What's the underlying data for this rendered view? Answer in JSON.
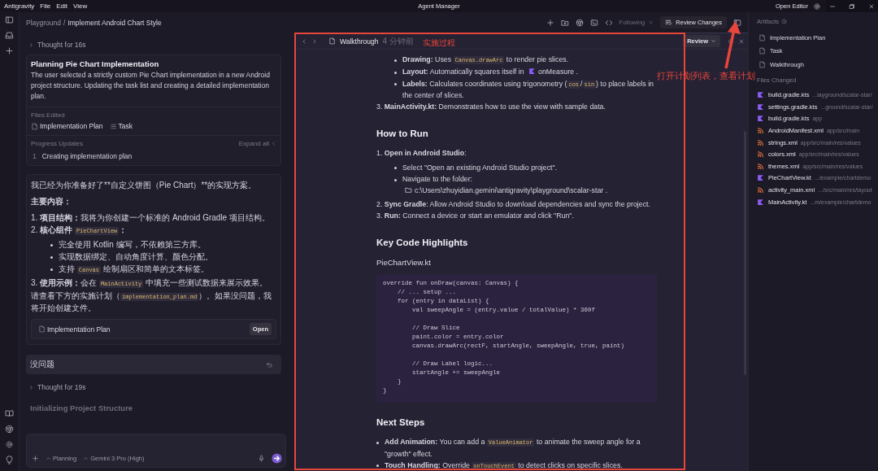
{
  "title_bar": {
    "menu": [
      "Antigravity",
      "File",
      "Edit",
      "View"
    ],
    "title": "Agent Manager",
    "open_editor": "Open Editor"
  },
  "conversation": {
    "breadcrumb": [
      "Playground",
      "Implement Android Chart Style"
    ],
    "breadcrumb_separator": "/",
    "thought_1": "Thought for 16s",
    "step_card": {
      "title": "Planning Pie Chart Implementation",
      "body": "The user selected a strictly custom Pie Chart implementation in a new Android project structure. Updating the task list and creating a detailed implementation plan.",
      "files_label": "Files Edited",
      "files": [
        {
          "name": "Implementation Plan",
          "kind": "doc"
        },
        {
          "name": "Task",
          "kind": "list"
        }
      ],
      "progress_label": "Progress Updates",
      "expand": "Expand all",
      "updates": [
        {
          "number": "1",
          "text": "Creating implementation plan"
        }
      ]
    },
    "message": {
      "blocks": [
        {
          "kind": "paragraph",
          "parts": [
            {
              "kind": "text",
              "text": "我已经为你准备好了**自定义饼图（Pie Chart）**的实现方案。"
            }
          ]
        },
        {
          "kind": "paragraph",
          "parts": [
            {
              "kind": "bold",
              "text": "主要内容："
            }
          ]
        },
        {
          "kind": "item",
          "number": "1.",
          "parts": [
            {
              "kind": "bold",
              "text": "项目结构："
            },
            {
              "kind": "text",
              "text": "我将为你创建一个标准的 Android Gradle 项目结构。"
            }
          ]
        },
        {
          "kind": "item",
          "number": "2.",
          "parts": [
            {
              "kind": "bold",
              "text": "核心组件 "
            },
            {
              "kind": "code",
              "text": "PieChartView"
            },
            {
              "kind": "bold",
              "text": "："
            }
          ],
          "children": [
            {
              "kind": "item",
              "parts": [
                {
                  "kind": "text",
                  "text": "完全使用 Kotlin 编写，不依赖第三方库。"
                }
              ]
            },
            {
              "kind": "item",
              "parts": [
                {
                  "kind": "text",
                  "text": "实现数据绑定、自动角度计算、颜色分配。"
                }
              ]
            },
            {
              "kind": "item",
              "parts": [
                {
                  "kind": "text",
                  "text": "支持 "
                },
                {
                  "kind": "code",
                  "text": "Canvas"
                },
                {
                  "kind": "text",
                  "text": " 绘制扇区和简单的文本标签。"
                }
              ]
            }
          ]
        },
        {
          "kind": "item",
          "number": "3.",
          "parts": [
            {
              "kind": "bold",
              "text": "使用示例："
            },
            {
              "kind": "text",
              "text": "会在 "
            },
            {
              "kind": "code",
              "text": "MainActivity"
            },
            {
              "kind": "text",
              "text": " 中填充一些测试数据来展示效果。"
            }
          ]
        },
        {
          "kind": "paragraph",
          "parts": [
            {
              "kind": "text",
              "text": "请查看下方的实施计划（"
            },
            {
              "kind": "code",
              "text": "implementation_plan.md"
            },
            {
              "kind": "text",
              "text": "）。如果没问题，我将开始创建文件。"
            }
          ]
        }
      ],
      "attachment": {
        "name": "Implementation Plan",
        "button": "Open"
      }
    },
    "user_message": "没问题",
    "thought_2": "Thought for 19s",
    "step_title": "Initializing Project Structure",
    "input": {
      "mode": "Planning",
      "model": "Gemini 3 Pro (High)"
    }
  },
  "toolbar": {
    "following": {
      "label": "Following",
      "disabled": true
    },
    "review_changes": "Review Changes"
  },
  "document": {
    "title": "Walkthrough",
    "age": "4 分钟前",
    "review": "Review",
    "blocks": [
      {
        "kind": "sub_item",
        "parts": [
          {
            "kind": "bold",
            "text": "Drawing:"
          },
          {
            "kind": "text",
            "text": " Uses "
          },
          {
            "kind": "code",
            "text": "Canvas.drawArc"
          },
          {
            "kind": "text",
            "text": " to render pie slices."
          }
        ]
      },
      {
        "kind": "sub_item",
        "parts": [
          {
            "kind": "bold",
            "text": "Layout:"
          },
          {
            "kind": "text",
            "text": " Automatically squares itself in "
          },
          {
            "kind": "file_icon"
          },
          {
            "kind": "text",
            "text": "onMeasure ."
          }
        ]
      },
      {
        "kind": "sub_item",
        "parts": [
          {
            "kind": "bold",
            "text": "Labels:"
          },
          {
            "kind": "text",
            "text": " Calculates coordinates using trigonometry ("
          },
          {
            "kind": "code",
            "text": "cos"
          },
          {
            "kind": "text",
            "text": "/"
          },
          {
            "kind": "code",
            "text": "sin"
          },
          {
            "kind": "text",
            "text": ") to place labels in the center of slices."
          }
        ]
      },
      {
        "kind": "item",
        "number": "3.",
        "parts": [
          {
            "kind": "bold",
            "text": "MainActivity.kt:"
          },
          {
            "kind": "text",
            "text": " Demonstrates how to use the view with sample data."
          }
        ]
      },
      {
        "kind": "heading",
        "text": "How to Run"
      },
      {
        "kind": "item",
        "number": "1.",
        "parts": [
          {
            "kind": "bold",
            "text": "Open in Android Studio"
          },
          {
            "kind": "text",
            "text": ":"
          }
        ],
        "children": [
          {
            "kind": "item",
            "parts": [
              {
                "kind": "text",
                "text": "Select \"Open an existing Android Studio project\"."
              }
            ]
          },
          {
            "kind": "item",
            "parts": [
              {
                "kind": "text",
                "text": "Navigate to the folder:"
              },
              {
                "kind": "break"
              },
              {
                "kind": "folder_icon"
              },
              {
                "kind": "text",
                "text": "c:\\Users\\zhuyidian.gemini\\antigravity\\playground\\scalar-star ."
              }
            ]
          }
        ]
      },
      {
        "kind": "item",
        "number": "2.",
        "parts": [
          {
            "kind": "bold",
            "text": "Sync Gradle"
          },
          {
            "kind": "text",
            "text": ": Allow Android Studio to download dependencies and sync the project."
          }
        ]
      },
      {
        "kind": "item",
        "number": "3.",
        "parts": [
          {
            "kind": "bold",
            "text": "Run:"
          },
          {
            "kind": "text",
            "text": " Connect a device or start an emulator and click \"Run\"."
          }
        ]
      },
      {
        "kind": "heading",
        "text": "Key Code Highlights"
      },
      {
        "kind": "label",
        "text": "PieChartView.kt"
      },
      {
        "kind": "code",
        "text": "override fun onDraw(canvas: Canvas) {\n    // ... setup ...\n    for (entry in dataList) {\n        val sweepAngle = (entry.value / totalValue) * 360f\n\n        // Draw Slice\n        paint.color = entry.color\n        canvas.drawArc(rectF, startAngle, sweepAngle, true, paint)\n\n        // Draw Label logic...\n        startAngle += sweepAngle\n    }\n}"
      },
      {
        "kind": "heading",
        "text": "Next Steps"
      },
      {
        "kind": "item",
        "parts": [
          {
            "kind": "bold",
            "text": "Add Animation:"
          },
          {
            "kind": "text",
            "text": " You can add a "
          },
          {
            "kind": "code",
            "text": "ValueAnimator"
          },
          {
            "kind": "text",
            "text": " to animate the sweep angle for a \"growth\" effect."
          }
        ]
      },
      {
        "kind": "item",
        "parts": [
          {
            "kind": "bold",
            "text": "Touch Handling:"
          },
          {
            "kind": "text",
            "text": " Override "
          },
          {
            "kind": "code",
            "text": "onTouchEvent"
          },
          {
            "kind": "text",
            "text": " to detect clicks on specific slices."
          }
        ]
      }
    ]
  },
  "artifacts": {
    "label": "Artifacts",
    "items": [
      "Implementation Plan",
      "Task",
      "Walkthrough"
    ],
    "files_label": "Files Changed",
    "files": [
      {
        "name": "build.gradle.kts",
        "path": "...layground/scalar-star/",
        "kind": "kotlin"
      },
      {
        "name": "settings.gradle.kts",
        "path": "...ground/scalar-star/",
        "kind": "kotlin"
      },
      {
        "name": "build.gradle.kts",
        "path": "app",
        "kind": "kotlin"
      },
      {
        "name": "AndroidManifest.xml",
        "path": "app/src/main",
        "kind": "xml"
      },
      {
        "name": "strings.xml",
        "path": "app/src/main/res/values",
        "kind": "xml"
      },
      {
        "name": "colors.xml",
        "path": "app/src/main/res/values",
        "kind": "xml"
      },
      {
        "name": "themes.xml",
        "path": "app/src/main/res/values",
        "kind": "xml"
      },
      {
        "name": "PieChartView.kt",
        "path": ".../example/chartdemo",
        "kind": "kotlin"
      },
      {
        "name": "activity_main.xml",
        "path": ".../src/main/res/layout",
        "kind": "xml"
      },
      {
        "name": "MainActivity.kt",
        "path": "...m/example/chartdemo",
        "kind": "kotlin"
      }
    ]
  },
  "annotations": [
    {
      "kind": "box_label",
      "text": "实施过程"
    },
    {
      "kind": "arrow_label",
      "text": "打开计划列表，查看计划"
    }
  ]
}
